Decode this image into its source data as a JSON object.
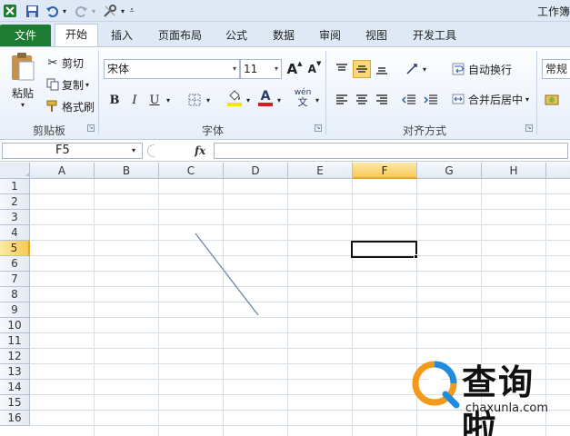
{
  "title": "工作簿",
  "quick_access": {
    "excel_icon": "excel-logo-icon",
    "save_icon": "save-icon",
    "undo_icon": "undo-icon",
    "redo_icon": "redo-icon",
    "tools_icon": "tools-icon",
    "customize_icon": "customize-arrow-icon"
  },
  "tabs": [
    {
      "label": "文件"
    },
    {
      "label": "开始"
    },
    {
      "label": "插入"
    },
    {
      "label": "页面布局"
    },
    {
      "label": "公式"
    },
    {
      "label": "数据"
    },
    {
      "label": "审阅"
    },
    {
      "label": "视图"
    },
    {
      "label": "开发工具"
    }
  ],
  "ribbon": {
    "clipboard": {
      "group_label": "剪贴板",
      "paste_label": "粘贴",
      "cut_label": "剪切",
      "copy_label": "复制",
      "format_painter_label": "格式刷"
    },
    "font": {
      "group_label": "字体",
      "font_name": "宋体",
      "font_size": "11",
      "bold_label": "B",
      "italic_label": "I",
      "underline_label": "U",
      "font_color_label": "A",
      "grow_label": "A",
      "shrink_label": "A",
      "phonetic_label": "wén"
    },
    "alignment": {
      "group_label": "对齐方式",
      "wrap_text_label": "自动换行",
      "merge_center_label": "合并后居中"
    },
    "number": {
      "format_value": "常规"
    }
  },
  "formula_bar": {
    "name_box": "F5",
    "fx_label": "fx",
    "formula_value": ""
  },
  "sheet": {
    "columns": [
      "A",
      "B",
      "C",
      "D",
      "E",
      "F",
      "G",
      "H"
    ],
    "rows": [
      "1",
      "2",
      "3",
      "4",
      "5",
      "6",
      "7",
      "8",
      "9",
      "10",
      "11",
      "12",
      "13",
      "14",
      "15",
      "16"
    ],
    "active_cell": "F5",
    "active_column": "F",
    "active_row": "5"
  },
  "watermark": {
    "name": "查询啦",
    "url": "chaxunla.com"
  },
  "colors": {
    "file_tab": "#1e7b34",
    "active_header": "#f8c957",
    "selection_border": "#111111",
    "underline_red": "#e01818",
    "highlight_yellow": "#f5e600",
    "watermark_orange": "#f39a1e",
    "watermark_blue": "#1e8de0"
  }
}
